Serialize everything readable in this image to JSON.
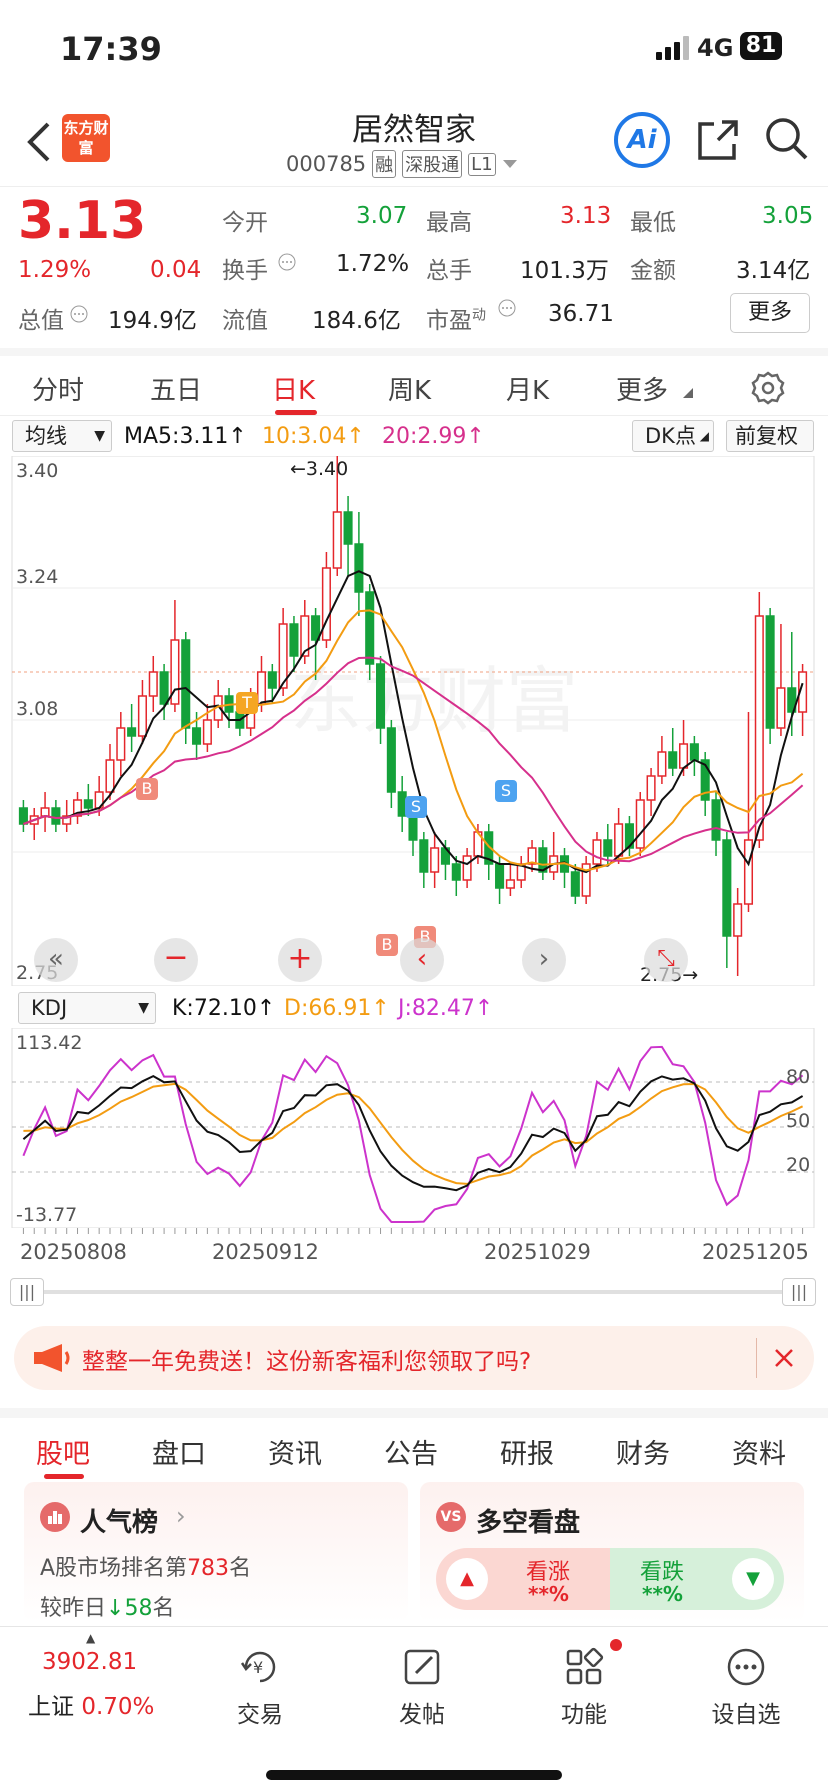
{
  "status_bar": {
    "time": "17:39",
    "network": "4G",
    "battery": "81"
  },
  "header": {
    "logo_text": "东方财富",
    "title": "居然智家",
    "code": "000785",
    "tags": [
      "融",
      "深股通",
      "L1"
    ],
    "ai_label": "Ai"
  },
  "quote": {
    "price": "3.13",
    "change_pct": "1.29%",
    "change": "0.04",
    "open_label": "今开",
    "open": "3.07",
    "high_label": "最高",
    "high": "3.13",
    "low_label": "最低",
    "low": "3.05",
    "turnover_label": "换手",
    "turnover": "1.72%",
    "volume_label": "总手",
    "volume": "101.3万",
    "amount_label": "金额",
    "amount": "3.14亿",
    "total_mv_label": "总值",
    "total_mv": "194.9亿",
    "float_mv_label": "流值",
    "float_mv": "184.6亿",
    "pe_label": "市盈",
    "pe_sup": "动",
    "pe": "36.71",
    "more_button": "更多"
  },
  "chart_tabs": [
    "分时",
    "五日",
    "日K",
    "周K",
    "月K",
    "更多"
  ],
  "ma_bar": {
    "indicator_select": "均线",
    "ma5": "MA5:3.11↑",
    "ma10": "10:3.04↑",
    "ma20": "20:2.99↑",
    "dk_button": "DK点",
    "adjust_button": "前复权"
  },
  "kline_labels": {
    "y_top": "3.40",
    "y_mid1": "3.24",
    "y_mid2": "3.08",
    "y_bottom": "2.75",
    "high_annot": "←3.40",
    "low_annot": "2.75→",
    "marker_b": "B",
    "marker_s": "S",
    "marker_t": "T"
  },
  "kdj_bar": {
    "indicator_select": "KDJ",
    "k": "K:72.10↑",
    "d": "D:66.91↑",
    "j": "J:82.47↑"
  },
  "kdj_labels": {
    "y_top": "113.42",
    "y_bottom": "-13.77",
    "l80": "80",
    "l50": "50",
    "l20": "20"
  },
  "dates": [
    "20250808",
    "20250912",
    "20251029",
    "20251205"
  ],
  "colors": {
    "up": "#e4262b",
    "down": "#14a13a",
    "ma5": "#111111",
    "ma10": "#f39c12",
    "ma20": "#d6308c",
    "j": "#cc33cc"
  },
  "banner": {
    "text": "整整一年免费送！这份新客福利您领取了吗?"
  },
  "bottom_tabs": [
    "股吧",
    "盘口",
    "资讯",
    "公告",
    "研报",
    "财务",
    "资料"
  ],
  "cards": {
    "popularity": {
      "title": "人气榜",
      "rank_prefix": "A股市场排名第",
      "rank": "783",
      "rank_suffix": "名",
      "change_prefix": "较昨日",
      "change": "58",
      "change_suffix": "名"
    },
    "bullbear": {
      "title": "多空看盘",
      "bull_label": "看涨",
      "bull_value": "**%",
      "bear_label": "看跌",
      "bear_value": "**%"
    }
  },
  "nav": {
    "index_value": "3902.81",
    "index_name": "上证",
    "index_change": "0.70%",
    "items": [
      "交易",
      "发帖",
      "功能",
      "设自选"
    ]
  },
  "chart_data": {
    "type": "candlestick",
    "y_range_kline": [
      2.75,
      3.4
    ],
    "y_range_kdj": [
      -13.77,
      113.42
    ],
    "visible_start": "20250808",
    "visible_end": "20251205",
    "last_close": 3.13,
    "period_high": 3.4,
    "period_low": 2.75,
    "ma": {
      "ma5": 3.11,
      "ma10": 3.04,
      "ma20": 2.99
    },
    "kdj_last": {
      "k": 72.1,
      "d": 66.91,
      "j": 82.47
    },
    "kdj_levels": [
      80,
      50,
      20
    ],
    "candles": [
      {
        "o": 2.96,
        "c": 2.94,
        "h": 2.97,
        "l": 2.93
      },
      {
        "o": 2.94,
        "c": 2.95,
        "h": 2.96,
        "l": 2.92
      },
      {
        "o": 2.95,
        "c": 2.96,
        "h": 2.98,
        "l": 2.93
      },
      {
        "o": 2.96,
        "c": 2.94,
        "h": 2.97,
        "l": 2.93
      },
      {
        "o": 2.94,
        "c": 2.95,
        "h": 2.97,
        "l": 2.93
      },
      {
        "o": 2.95,
        "c": 2.97,
        "h": 2.98,
        "l": 2.94
      },
      {
        "o": 2.97,
        "c": 2.96,
        "h": 2.99,
        "l": 2.95
      },
      {
        "o": 2.96,
        "c": 2.98,
        "h": 3.0,
        "l": 2.95
      },
      {
        "o": 2.98,
        "c": 3.02,
        "h": 3.04,
        "l": 2.97
      },
      {
        "o": 3.02,
        "c": 3.06,
        "h": 3.08,
        "l": 3.0
      },
      {
        "o": 3.06,
        "c": 3.05,
        "h": 3.09,
        "l": 3.03
      },
      {
        "o": 3.05,
        "c": 3.1,
        "h": 3.12,
        "l": 3.04
      },
      {
        "o": 3.1,
        "c": 3.13,
        "h": 3.15,
        "l": 3.08
      },
      {
        "o": 3.13,
        "c": 3.09,
        "h": 3.14,
        "l": 3.07
      },
      {
        "o": 3.09,
        "c": 3.17,
        "h": 3.22,
        "l": 3.08
      },
      {
        "o": 3.17,
        "c": 3.06,
        "h": 3.18,
        "l": 3.04
      },
      {
        "o": 3.06,
        "c": 3.04,
        "h": 3.08,
        "l": 3.02
      },
      {
        "o": 3.04,
        "c": 3.07,
        "h": 3.09,
        "l": 3.03
      },
      {
        "o": 3.07,
        "c": 3.1,
        "h": 3.12,
        "l": 3.06
      },
      {
        "o": 3.1,
        "c": 3.08,
        "h": 3.11,
        "l": 3.06
      },
      {
        "o": 3.08,
        "c": 3.06,
        "h": 3.09,
        "l": 3.05
      },
      {
        "o": 3.06,
        "c": 3.09,
        "h": 3.11,
        "l": 3.05
      },
      {
        "o": 3.09,
        "c": 3.13,
        "h": 3.15,
        "l": 3.08
      },
      {
        "o": 3.13,
        "c": 3.11,
        "h": 3.14,
        "l": 3.09
      },
      {
        "o": 3.11,
        "c": 3.19,
        "h": 3.21,
        "l": 3.1
      },
      {
        "o": 3.19,
        "c": 3.15,
        "h": 3.2,
        "l": 3.13
      },
      {
        "o": 3.15,
        "c": 3.2,
        "h": 3.22,
        "l": 3.14
      },
      {
        "o": 3.2,
        "c": 3.17,
        "h": 3.21,
        "l": 3.12
      },
      {
        "o": 3.17,
        "c": 3.26,
        "h": 3.28,
        "l": 3.16
      },
      {
        "o": 3.26,
        "c": 3.33,
        "h": 3.4,
        "l": 3.25
      },
      {
        "o": 3.33,
        "c": 3.29,
        "h": 3.35,
        "l": 3.25
      },
      {
        "o": 3.29,
        "c": 3.23,
        "h": 3.33,
        "l": 3.2
      },
      {
        "o": 3.23,
        "c": 3.14,
        "h": 3.24,
        "l": 3.12
      },
      {
        "o": 3.14,
        "c": 3.06,
        "h": 3.15,
        "l": 3.04
      },
      {
        "o": 3.06,
        "c": 2.98,
        "h": 3.07,
        "l": 2.96
      },
      {
        "o": 2.98,
        "c": 2.95,
        "h": 3.0,
        "l": 2.93
      },
      {
        "o": 2.95,
        "c": 2.92,
        "h": 2.97,
        "l": 2.9
      },
      {
        "o": 2.92,
        "c": 2.88,
        "h": 2.93,
        "l": 2.86
      },
      {
        "o": 2.88,
        "c": 2.91,
        "h": 2.93,
        "l": 2.86
      },
      {
        "o": 2.91,
        "c": 2.89,
        "h": 2.92,
        "l": 2.87
      },
      {
        "o": 2.89,
        "c": 2.87,
        "h": 2.9,
        "l": 2.85
      },
      {
        "o": 2.87,
        "c": 2.9,
        "h": 2.91,
        "l": 2.86
      },
      {
        "o": 2.9,
        "c": 2.93,
        "h": 2.94,
        "l": 2.89
      },
      {
        "o": 2.93,
        "c": 2.89,
        "h": 2.94,
        "l": 2.87
      },
      {
        "o": 2.89,
        "c": 2.86,
        "h": 2.9,
        "l": 2.84
      },
      {
        "o": 2.86,
        "c": 2.87,
        "h": 2.89,
        "l": 2.85
      },
      {
        "o": 2.87,
        "c": 2.89,
        "h": 2.9,
        "l": 2.86
      },
      {
        "o": 2.89,
        "c": 2.91,
        "h": 2.92,
        "l": 2.88
      },
      {
        "o": 2.91,
        "c": 2.88,
        "h": 2.92,
        "l": 2.87
      },
      {
        "o": 2.88,
        "c": 2.9,
        "h": 2.93,
        "l": 2.87
      },
      {
        "o": 2.9,
        "c": 2.88,
        "h": 2.91,
        "l": 2.86
      },
      {
        "o": 2.88,
        "c": 2.85,
        "h": 2.89,
        "l": 2.84
      },
      {
        "o": 2.85,
        "c": 2.89,
        "h": 2.9,
        "l": 2.84
      },
      {
        "o": 2.89,
        "c": 2.92,
        "h": 2.93,
        "l": 2.88
      },
      {
        "o": 2.92,
        "c": 2.9,
        "h": 2.94,
        "l": 2.89
      },
      {
        "o": 2.9,
        "c": 2.94,
        "h": 2.96,
        "l": 2.89
      },
      {
        "o": 2.94,
        "c": 2.91,
        "h": 2.95,
        "l": 2.9
      },
      {
        "o": 2.91,
        "c": 2.97,
        "h": 2.98,
        "l": 2.9
      },
      {
        "o": 2.97,
        "c": 3.0,
        "h": 3.01,
        "l": 2.95
      },
      {
        "o": 3.0,
        "c": 3.03,
        "h": 3.05,
        "l": 2.99
      },
      {
        "o": 3.03,
        "c": 3.01,
        "h": 3.06,
        "l": 3.0
      },
      {
        "o": 3.01,
        "c": 3.04,
        "h": 3.07,
        "l": 3.0
      },
      {
        "o": 3.04,
        "c": 3.02,
        "h": 3.05,
        "l": 3.0
      },
      {
        "o": 3.02,
        "c": 2.97,
        "h": 3.03,
        "l": 2.95
      },
      {
        "o": 2.97,
        "c": 2.92,
        "h": 2.98,
        "l": 2.9
      },
      {
        "o": 2.92,
        "c": 2.8,
        "h": 2.93,
        "l": 2.76
      },
      {
        "o": 2.8,
        "c": 2.84,
        "h": 2.86,
        "l": 2.75
      },
      {
        "o": 2.84,
        "c": 2.92,
        "h": 3.08,
        "l": 2.83
      },
      {
        "o": 2.92,
        "c": 3.2,
        "h": 3.23,
        "l": 2.91
      },
      {
        "o": 3.2,
        "c": 3.06,
        "h": 3.21,
        "l": 3.04
      },
      {
        "o": 3.06,
        "c": 3.11,
        "h": 3.19,
        "l": 3.05
      },
      {
        "o": 3.11,
        "c": 3.08,
        "h": 3.18,
        "l": 3.05
      },
      {
        "o": 3.08,
        "c": 3.13,
        "h": 3.14,
        "l": 3.05
      }
    ]
  }
}
